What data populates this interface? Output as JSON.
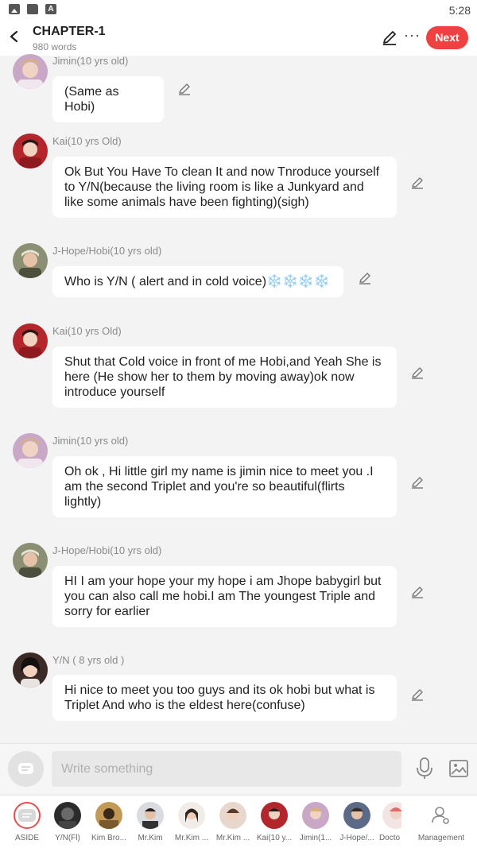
{
  "status_bar": {
    "time": "5:28"
  },
  "header": {
    "title": "CHAPTER-1",
    "subtitle": "980 words",
    "next_label": "Next"
  },
  "messages": [
    {
      "sender": "Jimin(10 yrs old)",
      "text": "(Same as Hobi)",
      "avatar": "jimin-avatar"
    },
    {
      "sender": "Kai(10 yrs Old)",
      "text": "Ok But You Have To clean It and now Tnroduce yourself to Y/N(because the living room is like a Junkyard and like some animals have been fighting)(sigh)",
      "avatar": "kai-avatar"
    },
    {
      "sender": "J-Hope/Hobi(10 yrs old)",
      "text": "Who is Y/N ( alert and in cold voice)❄️❄️❄️❄️",
      "avatar": "jhope-avatar"
    },
    {
      "sender": "Kai(10 yrs Old)",
      "text": "Shut that Cold voice in front of me Hobi,and Yeah She is here (He show her to them by moving away)ok now introduce yourself",
      "avatar": "kai-avatar"
    },
    {
      "sender": "Jimin(10 yrs old)",
      "text": "Oh ok , Hi little girl my name is jimin nice to meet you .I am the second Triplet and you're so beautiful(flirts lightly)",
      "avatar": "jimin-avatar"
    },
    {
      "sender": "J-Hope/Hobi(10 yrs old)",
      "text": "HI I am your hope your my hope i am Jhope babygirl but you can also call me hobi.I am The youngest Triple and sorry for earlier",
      "avatar": "jhope-avatar"
    },
    {
      "sender": "Y/N ( 8 yrs old )",
      "text": "Hi nice to meet you too guys and its ok hobi but what is Triplet And who is the eldest here(confuse)",
      "avatar": "yn-avatar"
    }
  ],
  "composer": {
    "placeholder": "Write something"
  },
  "characters": [
    {
      "label": "ASIDE",
      "icon": "aside-icon"
    },
    {
      "label": "Y/N(Fl)"
    },
    {
      "label": "Kim Bro..."
    },
    {
      "label": "Mr.Kim"
    },
    {
      "label": "Mr.Kim ..."
    },
    {
      "label": "Mr.Kim ..."
    },
    {
      "label": "Kai(10 y..."
    },
    {
      "label": "Jimin(1..."
    },
    {
      "label": "J-Hope/..."
    },
    {
      "label": "Docto"
    },
    {
      "label": "Management",
      "icon": "management-icon"
    }
  ],
  "colors": {
    "accent": "#f04040",
    "bubble": "#ffffff",
    "background": "#f3f3f3"
  }
}
